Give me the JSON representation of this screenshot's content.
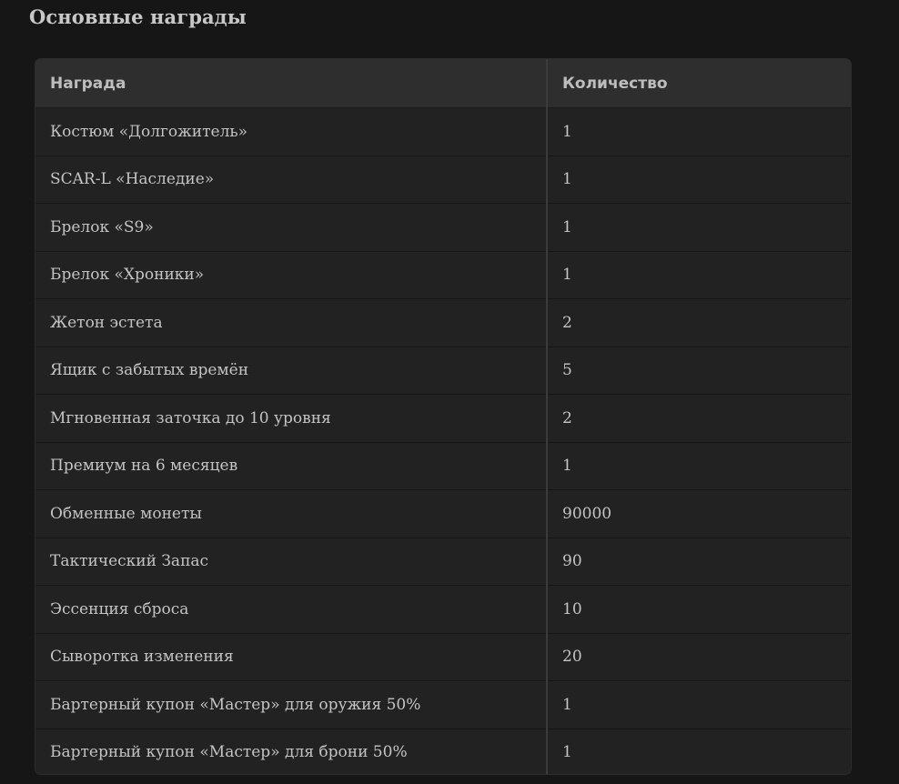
{
  "section": {
    "title": "Основные награды"
  },
  "table": {
    "headers": [
      "Награда",
      "Количество"
    ],
    "rows": [
      {
        "reward": "Костюм «Долгожитель»",
        "qty": "1"
      },
      {
        "reward": "SCAR-L «Наследие»",
        "qty": "1"
      },
      {
        "reward": "Брелок «S9»",
        "qty": "1"
      },
      {
        "reward": "Брелок «Хроники»",
        "qty": "1"
      },
      {
        "reward": "Жетон эстета",
        "qty": "2"
      },
      {
        "reward": "Ящик с забытых времён",
        "qty": "5"
      },
      {
        "reward": "Мгновенная заточка до 10 уровня",
        "qty": "2"
      },
      {
        "reward": "Премиум на 6 месяцев",
        "qty": "1"
      },
      {
        "reward": "Обменные монеты",
        "qty": "90000"
      },
      {
        "reward": "Тактический Запас",
        "qty": "90"
      },
      {
        "reward": "Эссенция сброса",
        "qty": "10"
      },
      {
        "reward": "Сыворотка изменения",
        "qty": "20"
      },
      {
        "reward": "Бартерный купон «Мастер» для оружия 50%",
        "qty": "1"
      },
      {
        "reward": "Бартерный купон «Мастер» для брони 50%",
        "qty": "1"
      }
    ]
  }
}
